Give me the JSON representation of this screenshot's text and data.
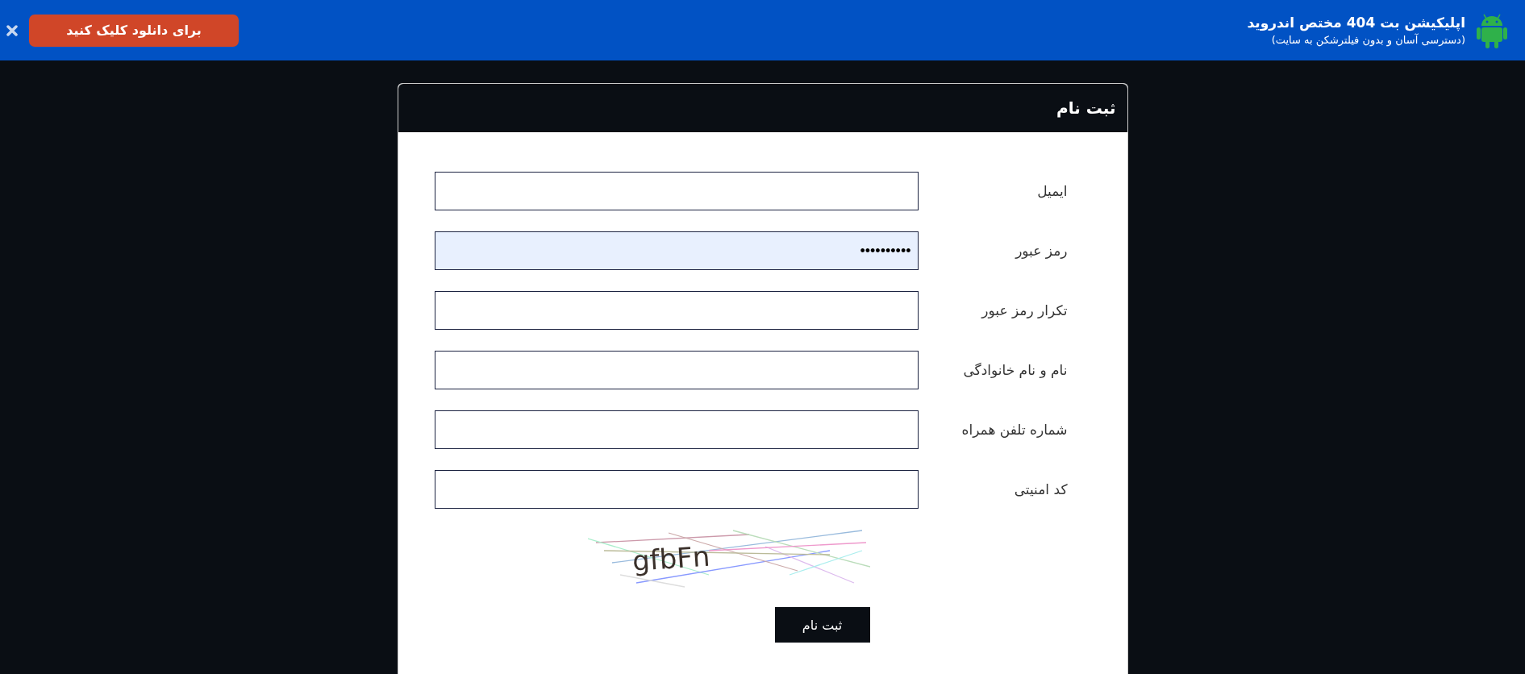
{
  "banner": {
    "title": "اپلیکیشن بت 404 مختص اندروید",
    "subtitle": "(دسترسی آسان و بدون فیلترشکن به سایت)",
    "download_button": "برای دانلود کلیک کنید"
  },
  "form": {
    "title": "ثبت نام",
    "fields": [
      {
        "label": "ایمیل",
        "autofilled": false
      },
      {
        "label": "رمز عبور",
        "value": "••••••••••",
        "autofilled": true
      },
      {
        "label": "تکرار رمز عبور",
        "autofilled": false
      },
      {
        "label": "نام و نام خانوادگی",
        "autofilled": false
      },
      {
        "label": "شماره تلفن همراه",
        "autofilled": false
      },
      {
        "label": "کد امنیتی",
        "autofilled": false
      }
    ],
    "captcha": {
      "text": "gfbFn"
    },
    "submit_button": "ثبت نام"
  }
}
